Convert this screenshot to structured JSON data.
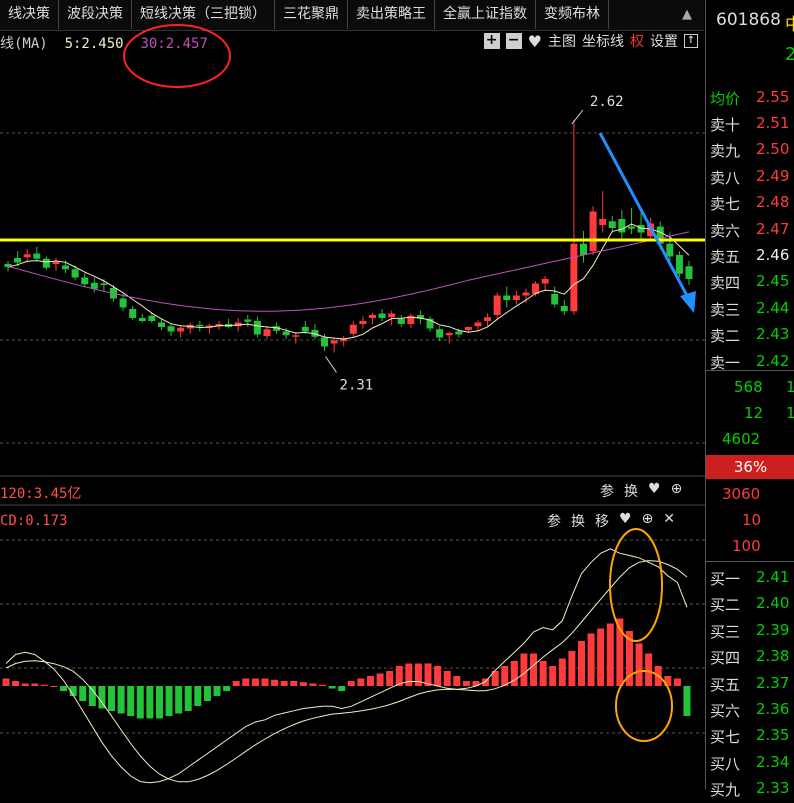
{
  "tabs": [
    "线决策",
    "波段决策",
    "短线决策（三把锁）",
    "三花聚鼎",
    "卖出策略王",
    "全赢上证指数",
    "变频布林"
  ],
  "tab_end_icon": "up-arrow",
  "ma_info": {
    "label": "线(MA)",
    "ma5": "5:2.450",
    "ma30": "30:2.457"
  },
  "toolbar": {
    "plus": "+",
    "minus": "−",
    "main": "主图",
    "axis": "坐标线",
    "right": "权",
    "settings": "设置"
  },
  "price_labels": {
    "high": "2.62",
    "low": "2.31"
  },
  "volume": {
    "label": "120:3.45亿",
    "tools": [
      "参",
      "换"
    ]
  },
  "macd": {
    "label": "CD:0.173",
    "tools": [
      "参",
      "换",
      "移"
    ]
  },
  "right_panel": {
    "code": "601868",
    "code_suffix": "中",
    "big": "2",
    "avg_label": "均价",
    "avg_value": "2.55",
    "sells": [
      [
        "卖十",
        "2.51"
      ],
      [
        "卖九",
        "2.50"
      ],
      [
        "卖八",
        "2.49"
      ],
      [
        "卖七",
        "2.48"
      ],
      [
        "卖六",
        "2.47"
      ],
      [
        "卖五",
        "2.46"
      ],
      [
        "卖四",
        "2.45"
      ],
      [
        "卖三",
        "2.44"
      ],
      [
        "卖二",
        "2.43"
      ],
      [
        "卖一",
        "2.42"
      ]
    ],
    "stats": [
      "568",
      "12",
      "4602"
    ],
    "stats_right": [
      "1",
      "1"
    ],
    "pct": "36%",
    "stats2": [
      "3060",
      "10",
      "100"
    ],
    "buys": [
      [
        "买一",
        "2.41"
      ],
      [
        "买二",
        "2.40"
      ],
      [
        "买三",
        "2.39"
      ],
      [
        "买四",
        "2.38"
      ],
      [
        "买五",
        "2.37"
      ],
      [
        "买六",
        "2.36"
      ],
      [
        "买七",
        "2.35"
      ],
      [
        "买八",
        "2.34"
      ],
      [
        "买九",
        "2.33"
      ]
    ]
  },
  "colors": {
    "up": "#ff3b3b",
    "down": "#23c33a",
    "ma5": "#f2eec0",
    "ma30": "#c050c0",
    "yellow": "#ffff00",
    "blue": "#1e90ff",
    "circle_red": "#ff2020",
    "circle_orange": "#ffa500"
  }
}
